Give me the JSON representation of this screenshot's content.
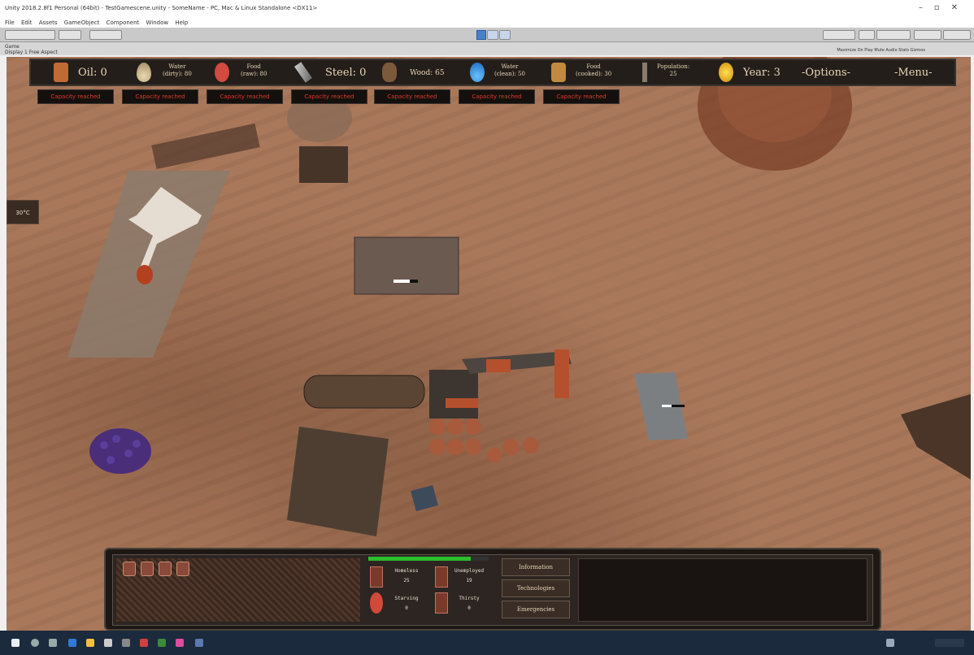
{
  "window": {
    "title": "Unity 2018.2.8f1 Personal (64bit) - TestGamescene.unity - SomeName - PC, Mac & Linux Standalone <DX11>",
    "menu": [
      "File",
      "Edit",
      "Assets",
      "GameObject",
      "Component",
      "Window",
      "Help"
    ],
    "tab_label": "Game",
    "sub_label": "Display 1   Free Aspect",
    "stats_label": "Maximize On Play  Mute Audio  Stats  Gizmos"
  },
  "resources": {
    "oil": "Oil: 0",
    "water_dirty": {
      "line1": "Water",
      "line2": "(dirty): 80"
    },
    "food_raw": {
      "line1": "Food",
      "line2": "(raw): 80"
    },
    "steel": "Steel: 0",
    "wood": "Wood: 65",
    "water_clean": {
      "line1": "Water",
      "line2": "(clean): 50"
    },
    "food_cooked": {
      "line1": "Food",
      "line2": "(cooked): 30"
    },
    "population": {
      "line1": "Population:",
      "line2": "25"
    },
    "year": "Year: 3",
    "options": "-Options-",
    "menu": "-Menu-"
  },
  "capacity_labels": [
    "Capacity reached",
    "Capacity reached",
    "Capacity reached",
    "Capacity reached",
    "Capacity reached",
    "Capacity reached",
    "Capacity reached"
  ],
  "temperature": "30°C",
  "panel": {
    "stats": {
      "homeless": {
        "label": "Homeless",
        "value": "25"
      },
      "unemployed": {
        "label": "Unemployed",
        "value": "19"
      },
      "starving": {
        "label": "Starving",
        "value": "0"
      },
      "thirsty": {
        "label": "Thirsty",
        "value": "0"
      }
    },
    "buttons": {
      "information": "Information",
      "technologies": "Technologies",
      "emergencies": "Emergencies"
    },
    "health_fraction": 0.85
  },
  "colors": {
    "sand": "#a9785b",
    "warning_text": "#e03a2a",
    "panel_bg": "#1e1814",
    "health_bar": "#2bbf2b"
  }
}
